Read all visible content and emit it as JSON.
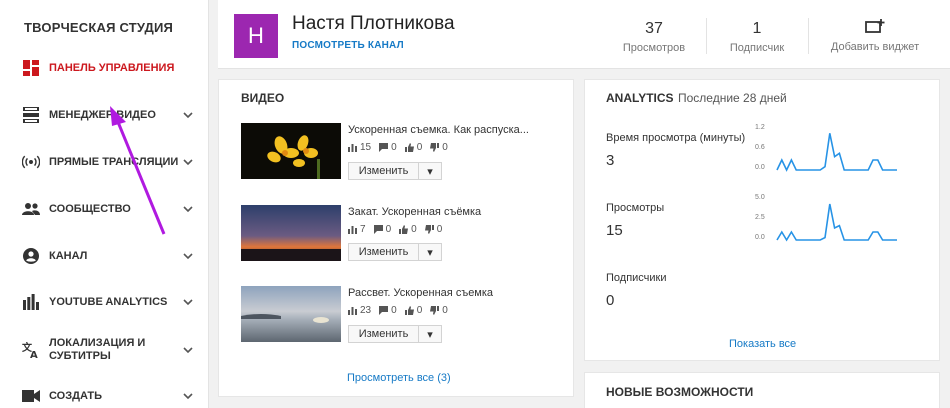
{
  "sidebar": {
    "title": "ТВОРЧЕСКАЯ СТУДИЯ",
    "items": [
      {
        "label": "ПАНЕЛЬ УПРАВЛЕНИЯ",
        "icon": "dashboard-icon",
        "active": true
      },
      {
        "label": "МЕНЕДЖЕР ВИДЕО",
        "icon": "video-manager-icon"
      },
      {
        "label": "ПРЯМЫЕ ТРАНСЛЯЦИИ",
        "icon": "live-broadcast-icon"
      },
      {
        "label": "СООБЩЕСТВО",
        "icon": "community-icon"
      },
      {
        "label": "КАНАЛ",
        "icon": "channel-icon"
      },
      {
        "label": "YOUTUBE ANALYTICS",
        "icon": "analytics-bars-icon"
      },
      {
        "label": "ЛОКАЛИЗАЦИЯ И СУБТИТРЫ",
        "icon": "translate-icon"
      },
      {
        "label": "СОЗДАТЬ",
        "icon": "camera-icon"
      }
    ]
  },
  "header": {
    "avatar_letter": "Н",
    "channel_name": "Настя Плотникова",
    "view_channel": "ПОСМОТРЕТЬ КАНАЛ",
    "views_value": "37",
    "views_label": "Просмотров",
    "subs_value": "1",
    "subs_label": "Подписчик",
    "add_widget": "Добавить виджет"
  },
  "videos": {
    "title": "ВИДЕО",
    "items": [
      {
        "title": "Ускоренная съемка. Как распуска...",
        "views": "15",
        "comments": "0",
        "likes": "0",
        "dislikes": "0",
        "edit": "Изменить"
      },
      {
        "title": "Закат. Ускоренная съёмка",
        "views": "7",
        "comments": "0",
        "likes": "0",
        "dislikes": "0",
        "edit": "Изменить"
      },
      {
        "title": "Рассвет. Ускоренная съемка",
        "views": "23",
        "comments": "0",
        "likes": "0",
        "dislikes": "0",
        "edit": "Изменить"
      }
    ],
    "view_all": "Просмотреть все (3)"
  },
  "analytics": {
    "title": "ANALYTICS",
    "period": "Последние 28 дней",
    "show_all": "Показать все",
    "line_color": "#2793e6",
    "metrics": [
      {
        "label": "Время просмотра (минуты)",
        "value": "3",
        "ticks": [
          "1.2",
          "0.6",
          "0.0"
        ]
      },
      {
        "label": "Просмотры",
        "value": "15",
        "ticks": [
          "5.0",
          "2.5",
          "0.0"
        ]
      },
      {
        "label": "Подписчики",
        "value": "0"
      }
    ]
  },
  "chart_data": [
    {
      "type": "line",
      "title": "Время просмотра (минуты)",
      "ylim": [
        0,
        1.2
      ],
      "values": [
        0,
        0.3,
        0,
        0.3,
        0,
        0,
        0,
        0,
        0,
        0,
        0.1,
        1.1,
        0.4,
        0.5,
        0,
        0,
        0,
        0,
        0,
        0,
        0.3,
        0.3,
        0,
        0,
        0,
        0
      ]
    },
    {
      "type": "line",
      "title": "Просмотры",
      "ylim": [
        0,
        5
      ],
      "values": [
        0,
        1,
        0,
        1,
        0,
        0,
        0,
        0,
        0,
        0,
        0.3,
        4.5,
        1.5,
        1.8,
        0,
        0,
        0,
        0,
        0,
        0,
        1,
        1,
        0,
        0,
        0,
        0
      ]
    }
  ],
  "news": {
    "title": "НОВЫЕ ВОЗМОЖНОСТИ"
  }
}
